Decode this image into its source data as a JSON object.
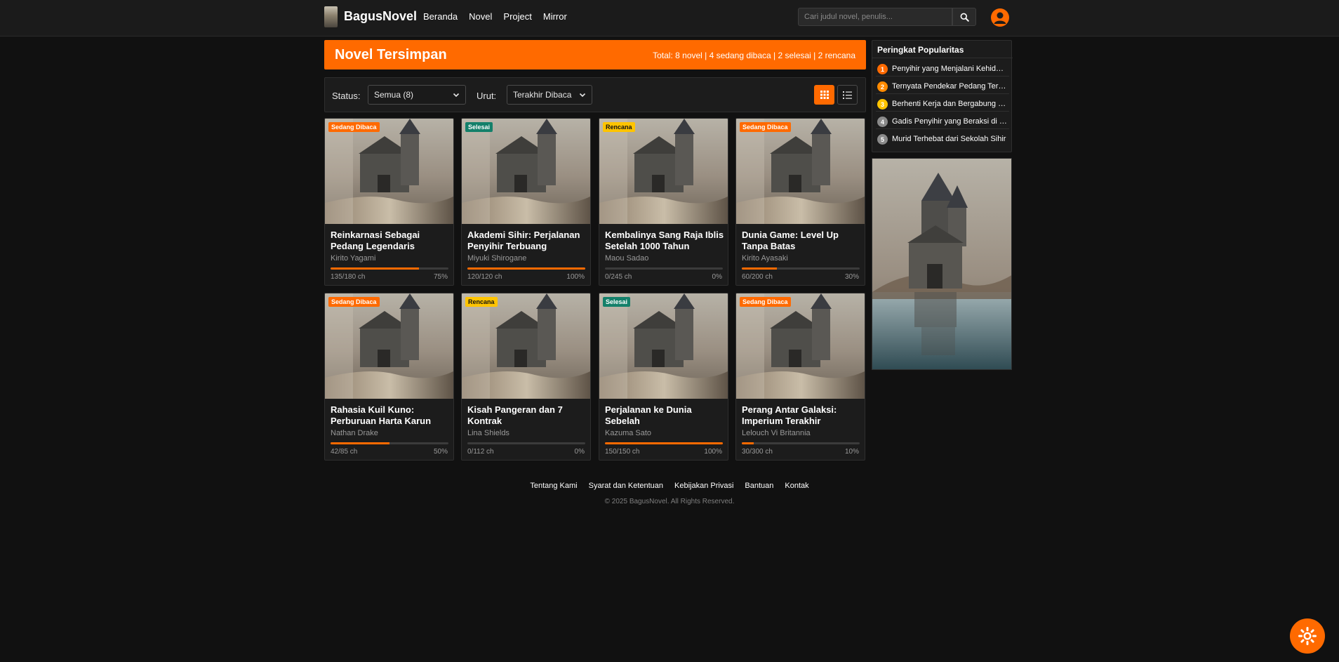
{
  "brand": {
    "name": "BagusNovel"
  },
  "nav": [
    {
      "label": "Beranda"
    },
    {
      "label": "Novel"
    },
    {
      "label": "Project"
    },
    {
      "label": "Mirror"
    }
  ],
  "search": {
    "placeholder": "Cari judul novel, penulis..."
  },
  "header": {
    "title": "Novel Tersimpan",
    "summary": "Total: 8 novel | 4 sedang dibaca | 2 selesai | 2 rencana"
  },
  "filters": {
    "status_label": "Status:",
    "status_value": "Semua (8)",
    "sort_label": "Urut:",
    "sort_value": "Terakhir Dibaca"
  },
  "novels": [
    {
      "status": "Sedang Dibaca",
      "title": "Reinkarnasi Sebagai Pedang Legendaris",
      "author": "Kirito Yagami",
      "chapters": "135/180 ch",
      "percent": "75%",
      "progress": 0.75
    },
    {
      "status": "Selesai",
      "title": "Akademi Sihir: Perjalanan Penyihir Terbuang",
      "author": "Miyuki Shirogane",
      "chapters": "120/120 ch",
      "percent": "100%",
      "progress": 1.0
    },
    {
      "status": "Rencana",
      "title": "Kembalinya Sang Raja Iblis Setelah 1000 Tahun",
      "author": "Maou Sadao",
      "chapters": "0/245 ch",
      "percent": "0%",
      "progress": 0
    },
    {
      "status": "Sedang Dibaca",
      "title": "Dunia Game: Level Up Tanpa Batas",
      "author": "Kirito Ayasaki",
      "chapters": "60/200 ch",
      "percent": "30%",
      "progress": 0.3
    },
    {
      "status": "Sedang Dibaca",
      "title": "Rahasia Kuil Kuno: Perburuan Harta Karun",
      "author": "Nathan Drake",
      "chapters": "42/85 ch",
      "percent": "50%",
      "progress": 0.5
    },
    {
      "status": "Rencana",
      "title": "Kisah Pangeran dan 7 Kontrak",
      "author": "Lina Shields",
      "chapters": "0/112 ch",
      "percent": "0%",
      "progress": 0
    },
    {
      "status": "Selesai",
      "title": "Perjalanan ke Dunia Sebelah",
      "author": "Kazuma Sato",
      "chapters": "150/150 ch",
      "percent": "100%",
      "progress": 1.0
    },
    {
      "status": "Sedang Dibaca",
      "title": "Perang Antar Galaksi: Imperium Terakhir",
      "author": "Lelouch Vi Britannia",
      "chapters": "30/300 ch",
      "percent": "10%",
      "progress": 0.1
    }
  ],
  "popular": {
    "title": "Peringkat Popularitas",
    "items": [
      {
        "rank": "1",
        "title": "Penyihir yang Menjalani Kehidupan Kedua",
        "color": "#ff6a00"
      },
      {
        "rank": "2",
        "title": "Ternyata Pendekar Pedang Terkuat",
        "color": "#ff8a00"
      },
      {
        "rank": "3",
        "title": "Berhenti Kerja dan Bergabung dengan Guild",
        "color": "#ffc400"
      },
      {
        "rank": "4",
        "title": "Gadis Penyihir yang Beraksi di Dunia Lain",
        "color": "#8a8a8a"
      },
      {
        "rank": "5",
        "title": "Murid Terhebat dari Sekolah Sihir",
        "color": "#8a8a8a"
      }
    ]
  },
  "footer": {
    "links": [
      {
        "label": "Tentang Kami"
      },
      {
        "label": "Syarat dan Ketentuan"
      },
      {
        "label": "Kebijakan Privasi"
      },
      {
        "label": "Bantuan"
      },
      {
        "label": "Kontak"
      }
    ],
    "copyright": "© 2025 BagusNovel. All Rights Reserved."
  },
  "colors": {
    "accent": "#ff6a00",
    "done": "#14806a",
    "plan": "#ffc400",
    "background": "#111111"
  }
}
